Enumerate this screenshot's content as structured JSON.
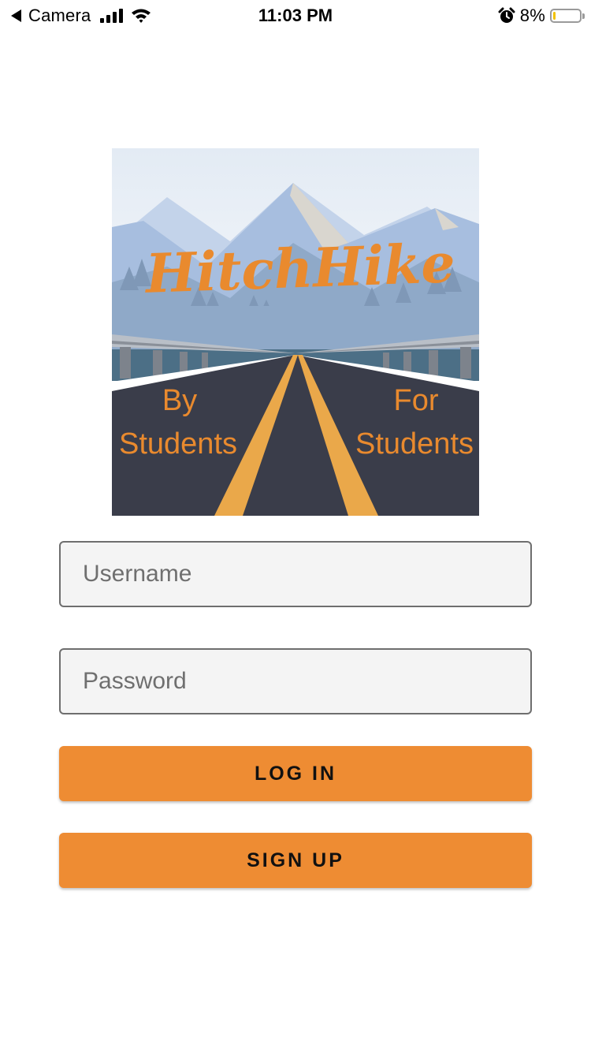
{
  "status_bar": {
    "back_label": "Camera",
    "time": "11:03 PM",
    "battery_percent": "8%",
    "battery_level": 0.08,
    "icons": [
      "back-arrow-icon",
      "cellular-signal-icon",
      "wifi-icon",
      "alarm-icon",
      "battery-icon"
    ]
  },
  "logo": {
    "title": "HitchHike",
    "left_tagline": [
      "By",
      "Students"
    ],
    "right_tagline": [
      "For",
      "Students"
    ],
    "colors": {
      "sky": "#e9eef5",
      "mountains": "#a7bedf",
      "road": "#3a3d4a",
      "lines": "#eaa84a",
      "accent": "#e98a2e"
    }
  },
  "form": {
    "username_placeholder": "Username",
    "password_placeholder": "Password",
    "login_label": "LOG IN",
    "signup_label": "SIGN UP"
  },
  "colors": {
    "button": "#ee8c33",
    "field_background": "#f4f4f4",
    "field_border": "#6e6e6e"
  }
}
